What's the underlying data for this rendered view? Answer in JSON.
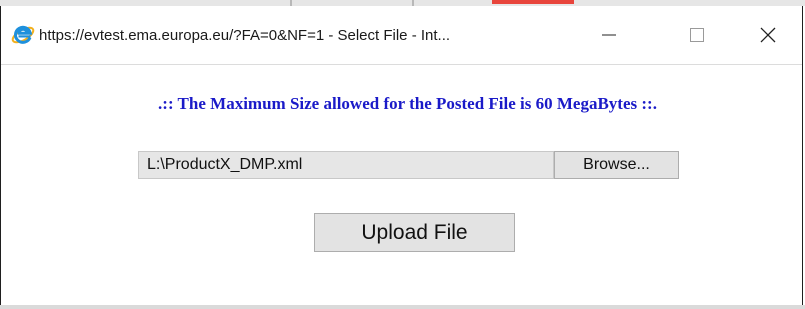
{
  "window": {
    "title": "https://evtest.ema.europa.eu/?FA=0&NF=1 - Select File - Int...",
    "minimize_glyph": "—",
    "maximize_glyph": "☐",
    "close_glyph": "✕",
    "browser_icon": "internet-explorer-icon"
  },
  "notice": {
    "text": ".:: The Maximum Size allowed for the Posted File is 60 MegaBytes ::."
  },
  "file_picker": {
    "value": "L:\\ProductX_DMP.xml",
    "browse_label": "Browse..."
  },
  "upload": {
    "label": "Upload File"
  },
  "colors": {
    "notice": "#1a1ac8",
    "ie_blue": "#1e90dc",
    "ie_gold": "#f2b01e",
    "button_face": "#e3e3e3"
  }
}
